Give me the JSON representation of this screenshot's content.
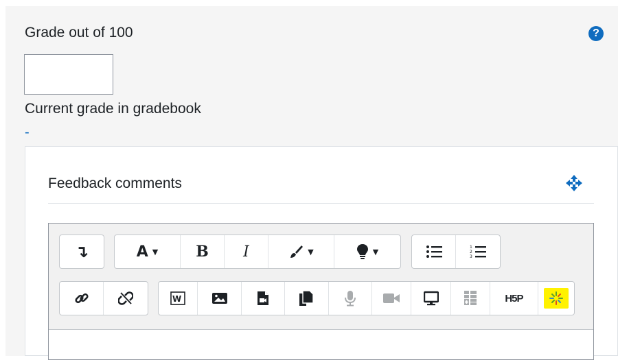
{
  "grade": {
    "label": "Grade out of 100",
    "input_value": "",
    "help_icon": "question-circle-icon"
  },
  "current_grade": {
    "label": "Current grade in gradebook",
    "value": "-"
  },
  "feedback": {
    "title": "Feedback comments",
    "move_icon": "arrows-move-icon"
  },
  "toolbar": {
    "row1": {
      "collapse": {
        "icon": "arrow-down-turn-icon",
        "glyph": "↴"
      },
      "font": {
        "label": "A",
        "caret": "▼"
      },
      "bold": {
        "label": "B"
      },
      "italic": {
        "label": "I"
      },
      "paint": {
        "icon": "paintbrush-icon",
        "caret": "▼"
      },
      "tip": {
        "icon": "lightbulb-icon",
        "caret": "▼"
      },
      "unordered_list": {
        "icon": "unordered-list-icon"
      },
      "ordered_list": {
        "icon": "ordered-list-icon"
      }
    },
    "row2": {
      "link": {
        "icon": "link-icon"
      },
      "unlink": {
        "icon": "unlink-icon"
      },
      "word": {
        "icon": "paste-from-word-icon"
      },
      "image": {
        "icon": "image-icon"
      },
      "media": {
        "icon": "media-file-icon"
      },
      "manage_files": {
        "icon": "manage-files-icon"
      },
      "record_audio": {
        "icon": "microphone-icon"
      },
      "record_video": {
        "icon": "video-camera-icon"
      },
      "screen": {
        "icon": "screen-icon"
      },
      "table": {
        "icon": "table-icon"
      },
      "h5p": {
        "label": "H5P"
      },
      "wiris": {
        "icon": "sparkle-icon",
        "highlight": "#fff200"
      }
    }
  },
  "colors": {
    "accent": "#0f6cbf",
    "panel_bg": "#f5f5f5",
    "toolbar_bg": "#f1f1f1",
    "highlight": "#fff200"
  }
}
